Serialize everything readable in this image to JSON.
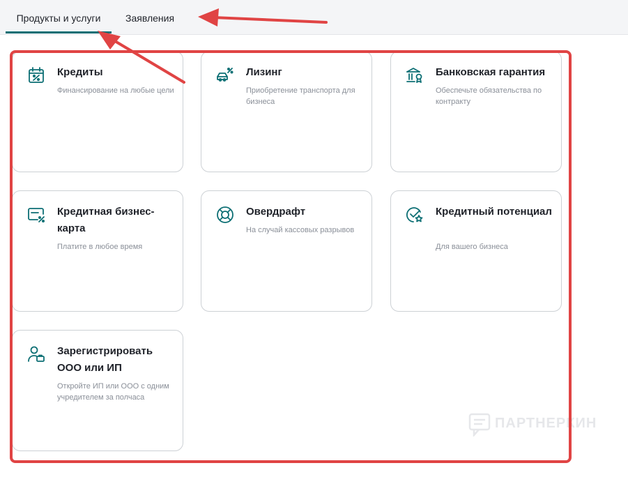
{
  "tabs": [
    {
      "label": "Продукты и услуги",
      "active": true
    },
    {
      "label": "Заявления",
      "active": false
    }
  ],
  "accent_color": "#0d6f74",
  "annotation_color": "#e04444",
  "cards": [
    {
      "title": "Кредиты",
      "description": "Финансирование на любые цели",
      "icon": "calendar-percent-icon"
    },
    {
      "title": "Лизинг",
      "description": "Приобретение транспорта для бизнеса",
      "icon": "car-percent-icon"
    },
    {
      "title": "Банковская гарантия",
      "description": "Обеспечьте обязательства по контракту",
      "icon": "bank-medal-icon"
    },
    {
      "title": "Кредитная бизнес-карта",
      "description": "Платите в любое время",
      "icon": "card-percent-icon"
    },
    {
      "title": "Овердрафт",
      "description": "На случай кассовых разрывов",
      "icon": "lifebuoy-icon"
    },
    {
      "title": "Кредитный потенциал",
      "description": "Для вашего бизнеса",
      "icon": "check-star-icon"
    },
    {
      "title": "Зарегистрировать ООО или ИП",
      "description": "Откройте ИП или ООО с одним учредителем за полчаса",
      "icon": "user-briefcase-icon"
    }
  ],
  "watermark": {
    "text": "ПАРТНЕРКИН"
  }
}
